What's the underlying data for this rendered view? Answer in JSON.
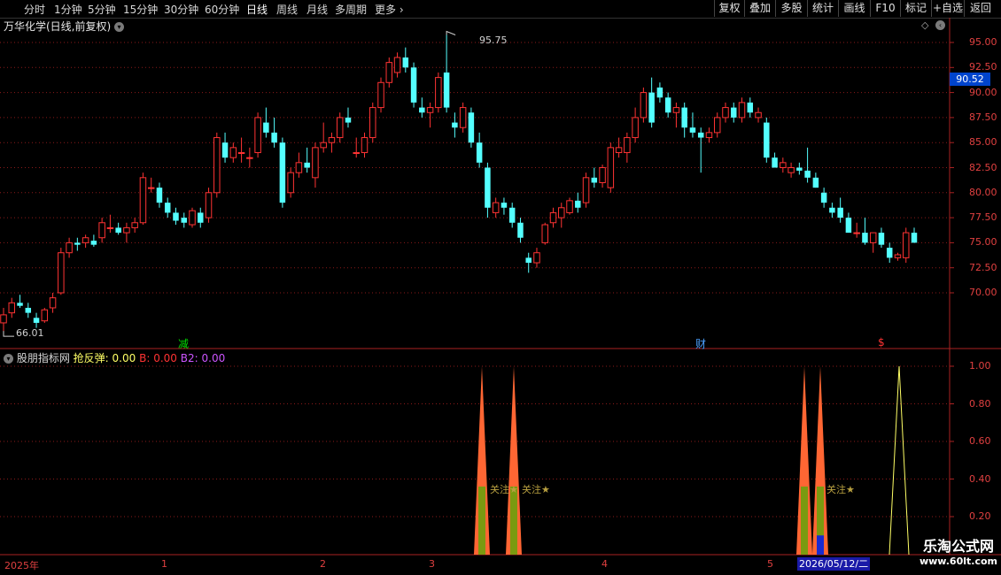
{
  "toolbar": {
    "periods": [
      "分时",
      "1分钟",
      "5分钟",
      "15分钟",
      "30分钟",
      "60分钟",
      "日线",
      "周线",
      "月线",
      "多周期",
      "更多"
    ],
    "active_period": "日线",
    "buttons": [
      "复权",
      "叠加",
      "多股",
      "统计",
      "画线",
      "F10",
      "标记",
      "+自选",
      "返回"
    ]
  },
  "stock": {
    "title": "万华化学(日线,前复权)",
    "high_label": "95.75",
    "low_label": "66.01",
    "current_price": "90.52"
  },
  "markers": {
    "m1": "减",
    "m2": "财",
    "m3": "$"
  },
  "indicator": {
    "name": "股朋指标网",
    "l1": "抢反弹:",
    "v1": "0.00",
    "l2": "B:",
    "v2": "0.00",
    "l3": "B2:",
    "v3": "0.00",
    "annotation": "关注★"
  },
  "axis": {
    "price_ticks": [
      "95.00",
      "92.50",
      "90.00",
      "87.50",
      "85.00",
      "82.50",
      "80.00",
      "77.50",
      "75.00",
      "72.50",
      "70.00"
    ],
    "ind_ticks": [
      "1.00",
      "0.80",
      "0.60",
      "0.40",
      "0.20"
    ],
    "x_labels": [
      "2025年",
      "1",
      "2",
      "3",
      "4",
      "5"
    ],
    "crosshair_date": "2026/05/12/二"
  },
  "watermark": {
    "title": "乐淘公式网",
    "url": "www.60lt.com"
  },
  "colors": {
    "up": "#ff3333",
    "down": "#54ffff",
    "grid": "#8b1a1a",
    "spike": "#ff6633",
    "inner": "#7a9a10",
    "line": "#ffff66"
  },
  "chart_data": {
    "type": "candlestick",
    "price_range": [
      66.01,
      95.75
    ],
    "ohlc_approx": [
      [
        67.0,
        68.5,
        66.0,
        67.8
      ],
      [
        68.0,
        69.5,
        67.5,
        69.0
      ],
      [
        69.0,
        69.8,
        68.5,
        68.7
      ],
      [
        68.5,
        69.0,
        67.5,
        68.0
      ],
      [
        67.5,
        68.0,
        66.5,
        67.0
      ],
      [
        67.2,
        68.5,
        67.0,
        68.3
      ],
      [
        68.5,
        70.0,
        68.0,
        69.5
      ],
      [
        70.0,
        74.5,
        69.8,
        74.0
      ],
      [
        74.0,
        75.5,
        73.5,
        75.0
      ],
      [
        75.0,
        75.5,
        74.2,
        74.8
      ],
      [
        75.0,
        75.8,
        74.5,
        75.5
      ],
      [
        75.2,
        75.8,
        74.6,
        74.8
      ],
      [
        75.5,
        77.5,
        75.0,
        77.0
      ],
      [
        76.5,
        77.8,
        76.0,
        76.5
      ],
      [
        76.5,
        77.0,
        75.8,
        76.0
      ],
      [
        76.0,
        77.0,
        75.0,
        76.5
      ],
      [
        76.5,
        77.5,
        76.0,
        77.0
      ],
      [
        77.0,
        82.0,
        76.8,
        81.5
      ],
      [
        80.5,
        81.5,
        80.0,
        80.5
      ],
      [
        80.5,
        81.0,
        78.5,
        79.0
      ],
      [
        79.0,
        79.5,
        77.5,
        78.0
      ],
      [
        78.0,
        78.5,
        76.8,
        77.2
      ],
      [
        77.5,
        78.0,
        76.5,
        77.0
      ],
      [
        76.8,
        78.5,
        76.5,
        78.2
      ],
      [
        78.0,
        78.5,
        76.5,
        77.0
      ],
      [
        77.5,
        80.5,
        77.0,
        80.0
      ],
      [
        80.0,
        86.0,
        79.5,
        85.5
      ],
      [
        85.0,
        86.0,
        83.0,
        83.5
      ],
      [
        83.5,
        85.0,
        83.0,
        84.5
      ],
      [
        84.0,
        85.5,
        83.0,
        84.0
      ],
      [
        83.5,
        84.5,
        82.5,
        83.5
      ],
      [
        84.0,
        88.0,
        83.5,
        87.5
      ],
      [
        87.0,
        88.5,
        85.5,
        86.0
      ],
      [
        86.0,
        87.5,
        84.5,
        85.0
      ],
      [
        85.0,
        85.5,
        78.5,
        79.0
      ],
      [
        80.0,
        82.5,
        79.5,
        82.0
      ],
      [
        82.0,
        84.0,
        81.5,
        83.0
      ],
      [
        83.0,
        84.5,
        82.0,
        82.5
      ],
      [
        81.5,
        85.0,
        80.5,
        84.5
      ],
      [
        84.5,
        87.0,
        84.0,
        85.0
      ],
      [
        85.0,
        86.0,
        84.0,
        85.5
      ],
      [
        85.5,
        88.0,
        85.0,
        87.5
      ],
      [
        87.5,
        88.5,
        86.5,
        87.0
      ],
      [
        84.0,
        85.5,
        83.5,
        84.0
      ],
      [
        84.0,
        86.0,
        83.5,
        85.5
      ],
      [
        85.5,
        89.0,
        85.0,
        88.5
      ],
      [
        88.5,
        91.5,
        88.0,
        91.0
      ],
      [
        91.0,
        93.5,
        90.5,
        93.0
      ],
      [
        92.0,
        94.0,
        91.5,
        93.5
      ],
      [
        93.5,
        94.5,
        92.0,
        92.5
      ],
      [
        92.5,
        93.0,
        88.5,
        89.0
      ],
      [
        88.5,
        89.5,
        87.5,
        88.0
      ],
      [
        88.0,
        89.0,
        86.5,
        88.5
      ],
      [
        88.5,
        92.0,
        88.0,
        91.5
      ],
      [
        92.0,
        95.75,
        88.0,
        88.5
      ],
      [
        87.0,
        88.0,
        85.5,
        86.5
      ],
      [
        86.5,
        89.0,
        86.0,
        88.5
      ],
      [
        88.0,
        88.5,
        84.5,
        85.0
      ],
      [
        85.0,
        86.0,
        82.5,
        83.0
      ],
      [
        82.5,
        83.0,
        77.5,
        78.5
      ],
      [
        78.0,
        79.5,
        77.5,
        79.0
      ],
      [
        79.0,
        79.5,
        77.8,
        78.5
      ],
      [
        78.5,
        79.0,
        76.5,
        77.0
      ],
      [
        77.0,
        77.5,
        75.0,
        75.5
      ],
      [
        73.5,
        74.0,
        72.0,
        73.0
      ],
      [
        73.0,
        74.5,
        72.5,
        74.0
      ],
      [
        75.0,
        77.0,
        74.8,
        76.8
      ],
      [
        77.0,
        78.5,
        76.5,
        78.0
      ],
      [
        77.5,
        79.0,
        76.5,
        78.5
      ],
      [
        78.0,
        79.5,
        77.8,
        79.2
      ],
      [
        79.2,
        80.0,
        78.0,
        78.5
      ],
      [
        79.0,
        82.0,
        78.5,
        81.5
      ],
      [
        81.5,
        82.5,
        80.5,
        81.0
      ],
      [
        81.0,
        82.8,
        80.5,
        82.5
      ],
      [
        80.5,
        85.0,
        80.0,
        84.5
      ],
      [
        84.0,
        85.5,
        83.5,
        84.5
      ],
      [
        84.0,
        86.0,
        83.0,
        85.5
      ],
      [
        85.5,
        88.5,
        85.0,
        87.5
      ],
      [
        87.5,
        90.5,
        87.0,
        90.0
      ],
      [
        90.0,
        91.5,
        86.5,
        87.0
      ],
      [
        90.5,
        91.0,
        89.0,
        89.5
      ],
      [
        89.5,
        90.0,
        87.5,
        88.0
      ],
      [
        88.0,
        89.0,
        86.5,
        88.5
      ],
      [
        88.5,
        89.0,
        85.5,
        86.5
      ],
      [
        86.5,
        88.0,
        85.5,
        86.0
      ],
      [
        86.0,
        86.5,
        82.0,
        85.5
      ],
      [
        85.5,
        86.5,
        85.0,
        86.0
      ],
      [
        86.0,
        88.0,
        85.5,
        87.5
      ],
      [
        87.5,
        89.0,
        87.0,
        88.5
      ],
      [
        88.5,
        89.0,
        87.0,
        87.5
      ],
      [
        87.5,
        89.5,
        87.0,
        89.0
      ],
      [
        89.0,
        89.5,
        87.5,
        88.0
      ],
      [
        87.5,
        88.5,
        87.0,
        88.0
      ],
      [
        87.0,
        87.5,
        83.0,
        83.5
      ],
      [
        83.5,
        84.0,
        82.5,
        82.5
      ],
      [
        82.5,
        83.5,
        82.0,
        83.0
      ],
      [
        82.0,
        83.0,
        81.5,
        82.5
      ],
      [
        82.5,
        83.0,
        81.8,
        82.2
      ],
      [
        82.2,
        84.5,
        81.0,
        81.5
      ],
      [
        81.5,
        82.0,
        80.5,
        80.5
      ],
      [
        80.0,
        80.5,
        78.5,
        79.0
      ],
      [
        78.5,
        79.0,
        77.5,
        78.0
      ],
      [
        78.5,
        79.5,
        77.0,
        77.5
      ],
      [
        77.5,
        78.0,
        76.0,
        76.0
      ],
      [
        76.0,
        77.0,
        75.5,
        76.0
      ],
      [
        76.0,
        77.5,
        74.8,
        75.0
      ],
      [
        75.0,
        76.0,
        74.0,
        76.0
      ],
      [
        76.0,
        76.5,
        74.5,
        74.8
      ],
      [
        74.5,
        75.0,
        73.0,
        73.5
      ],
      [
        73.5,
        74.0,
        73.2,
        73.8
      ],
      [
        73.5,
        76.5,
        73.0,
        76.0
      ],
      [
        76.0,
        76.5,
        75.0,
        75.0
      ]
    ],
    "indicator": {
      "ylim": [
        0,
        1
      ],
      "ticks": [
        1.0,
        0.8,
        0.6,
        0.4,
        0.2
      ],
      "spikes_x_index": [
        77,
        82,
        129,
        132
      ],
      "yellow_spike_index": 144
    }
  }
}
